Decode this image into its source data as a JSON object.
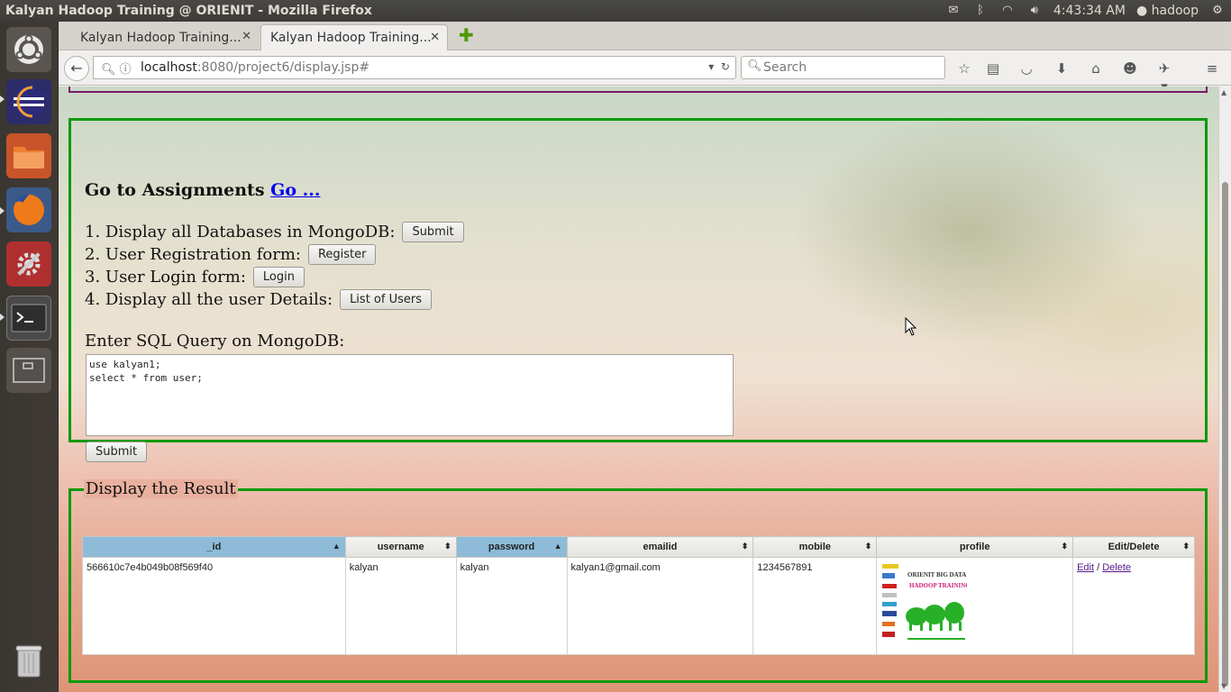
{
  "os": {
    "window_title": "Kalyan Hadoop Training @ ORIENIT - Mozilla Firefox",
    "clock": "4:43:34 AM",
    "user": "hadoop"
  },
  "browser": {
    "tabs": [
      {
        "label": "Kalyan Hadoop Training...",
        "active": false
      },
      {
        "label": "Kalyan Hadoop Training...",
        "active": true
      }
    ],
    "url_host": "localhost",
    "url_rest": ":8080/project6/display.jsp#",
    "search_placeholder": "Search"
  },
  "page": {
    "assign_text": "Go to Assignments",
    "assign_link": "Go ...",
    "menu": [
      {
        "text": "1. Display all Databases in MongoDB:",
        "button": "Submit"
      },
      {
        "text": "2. User Registration form:",
        "button": "Register"
      },
      {
        "text": "3. User Login form:",
        "button": "Login"
      },
      {
        "text": "4. Display all the user Details:",
        "button": "List of Users"
      }
    ],
    "sql_label": "Enter SQL Query on MongoDB:",
    "sql_query": "use kalyan1;\nselect * from user;",
    "sql_submit": "Submit",
    "result_legend": "Display the Result"
  },
  "table": {
    "columns": [
      "_id",
      "username",
      "password",
      "emailid",
      "mobile",
      "profile",
      "Edit/Delete"
    ],
    "sorted_columns": [
      "_id",
      "password"
    ],
    "rows": [
      {
        "_id": "566610c7e4b049b08f569f40",
        "username": "kalyan",
        "password": "kalyan",
        "emailid": "kalyan1@gmail.com",
        "mobile": "1234567891",
        "profile_lines": [
          "ORIENIT BIG DATA",
          "HADOOP TRAINING"
        ],
        "edit": "Edit",
        "sep": "/",
        "delete": "Delete"
      }
    ]
  },
  "colors": {
    "fieldset_border": "#0a9a0a",
    "sorted_header": "#8dbbd8",
    "link": "#0000ee"
  }
}
